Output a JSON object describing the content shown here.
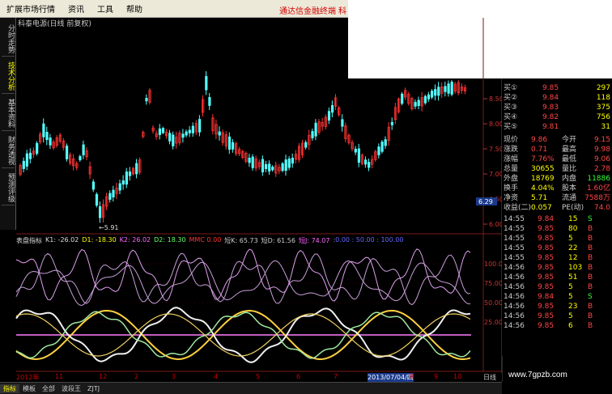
{
  "menu": {
    "items": [
      "扩展市场行情",
      "资讯",
      "工具",
      "帮助"
    ],
    "promo": "通达信金融终端",
    "promo_tail": "科"
  },
  "left_tabs": [
    {
      "label": "分时走势",
      "active": false
    },
    {
      "label": "技术分析",
      "active": true
    },
    {
      "label": "基本资料",
      "active": false
    },
    {
      "label": "财务透视",
      "active": false
    },
    {
      "label": "预测评级",
      "active": false
    }
  ],
  "chart": {
    "title": "科泰电源(日线 前复权)",
    "low_marker": "←5.91",
    "price_axis": [
      "8.50",
      "8.00",
      "7.50",
      "7.00",
      "6.50",
      "6.00"
    ],
    "current_price_tag": "6.29"
  },
  "indicator": {
    "header": [
      {
        "text": "表盘指标",
        "color": "#dddddd"
      },
      {
        "text": "K1: -26.02",
        "color": "#dddddd"
      },
      {
        "text": "D1: -18.30",
        "color": "#ffff00"
      },
      {
        "text": "K2: 26.02",
        "color": "#ff66ff"
      },
      {
        "text": "D2: 18.30",
        "color": "#66ff66"
      },
      {
        "text": "MMC 0.00",
        "color": "#ff3333"
      },
      {
        "text": "短K: 65.73",
        "color": "#cccccc"
      },
      {
        "text": "短D: 61.56",
        "color": "#cccccc"
      },
      {
        "text": "短J: 74.07",
        "color": "#ff66ff"
      },
      {
        "text": ":0.00 : 50.00 : 100.00",
        "color": "#6666ff"
      }
    ],
    "axis": [
      "100.0",
      "75.00",
      "50.00",
      "25.00"
    ]
  },
  "quote_panel": {
    "buy": [
      {
        "label": "买①",
        "price": "9.85",
        "vol": "297"
      },
      {
        "label": "买②",
        "price": "9.84",
        "vol": "118"
      },
      {
        "label": "买③",
        "price": "9.83",
        "vol": "375"
      },
      {
        "label": "买④",
        "price": "9.82",
        "vol": "756"
      },
      {
        "label": "买⑤",
        "price": "9.81",
        "vol": "31"
      }
    ],
    "stats": [
      {
        "l1": "现价",
        "v1": "9.86",
        "l2": "今开",
        "v2": "9.15"
      },
      {
        "l1": "涨跌",
        "v1": "0.71",
        "l2": "最高",
        "v2": "9.98"
      },
      {
        "l1": "涨幅",
        "v1": "7.76%",
        "l2": "最低",
        "v2": "9.06"
      },
      {
        "l1": "总量",
        "v1": "30655",
        "l2": "量比",
        "v2": "2.78"
      },
      {
        "l1": "外盘",
        "v1": "18769",
        "l2": "内盘",
        "v2": "11886"
      },
      {
        "l1": "换手",
        "v1": "4.04%",
        "l2": "股本",
        "v2": "1.60亿"
      },
      {
        "l1": "净资",
        "v1": "5.71",
        "l2": "流通",
        "v2": "7588万"
      },
      {
        "l1": "收益(二)",
        "v1": "0.057",
        "l2": "PE(动)",
        "v2": "74.0"
      }
    ],
    "ticks": [
      {
        "time": "14:55",
        "price": "9.84",
        "vol": "15",
        "flag": "S"
      },
      {
        "time": "14:55",
        "price": "9.85",
        "vol": "80",
        "flag": "B"
      },
      {
        "time": "14:55",
        "price": "9.85",
        "vol": "5",
        "flag": "B"
      },
      {
        "time": "14:55",
        "price": "9.85",
        "vol": "22",
        "flag": "B"
      },
      {
        "time": "14:55",
        "price": "9.85",
        "vol": "12",
        "flag": "B"
      },
      {
        "time": "14:56",
        "price": "9.85",
        "vol": "103",
        "flag": "B"
      },
      {
        "time": "14:56",
        "price": "9.85",
        "vol": "51",
        "flag": "B"
      },
      {
        "time": "14:56",
        "price": "9.85",
        "vol": "5",
        "flag": "B"
      },
      {
        "time": "14:56",
        "price": "9.84",
        "vol": "5",
        "flag": "S"
      },
      {
        "time": "14:56",
        "price": "9.85",
        "vol": "23",
        "flag": "B"
      },
      {
        "time": "14:56",
        "price": "9.85",
        "vol": "5",
        "flag": "B"
      },
      {
        "time": "14:56",
        "price": "9.85",
        "vol": "6",
        "flag": "B"
      }
    ]
  },
  "date_axis": {
    "labels": [
      "2012年",
      "11",
      "12",
      "2",
      "3",
      "4",
      "5",
      "6",
      "7",
      "2013/07/04/四",
      "8",
      "9",
      "10"
    ],
    "period": "日线"
  },
  "bottom_tabs": [
    {
      "label": "指标",
      "active": true
    },
    {
      "label": "模板",
      "active": false
    },
    {
      "label": "全部",
      "active": false
    },
    {
      "label": "波段王",
      "active": false
    },
    {
      "label": "ZJTJ",
      "active": false
    }
  ],
  "watermark": "www.7gpzb.com",
  "colors": {
    "up": "#ff3333",
    "down": "#54ffff",
    "k_line": "#ffd040",
    "d_line": "#f0f0f0",
    "green_line": "#9fe8a0",
    "magenta_line": "#ff80ff",
    "purple_line": "#c8a0d8"
  }
}
